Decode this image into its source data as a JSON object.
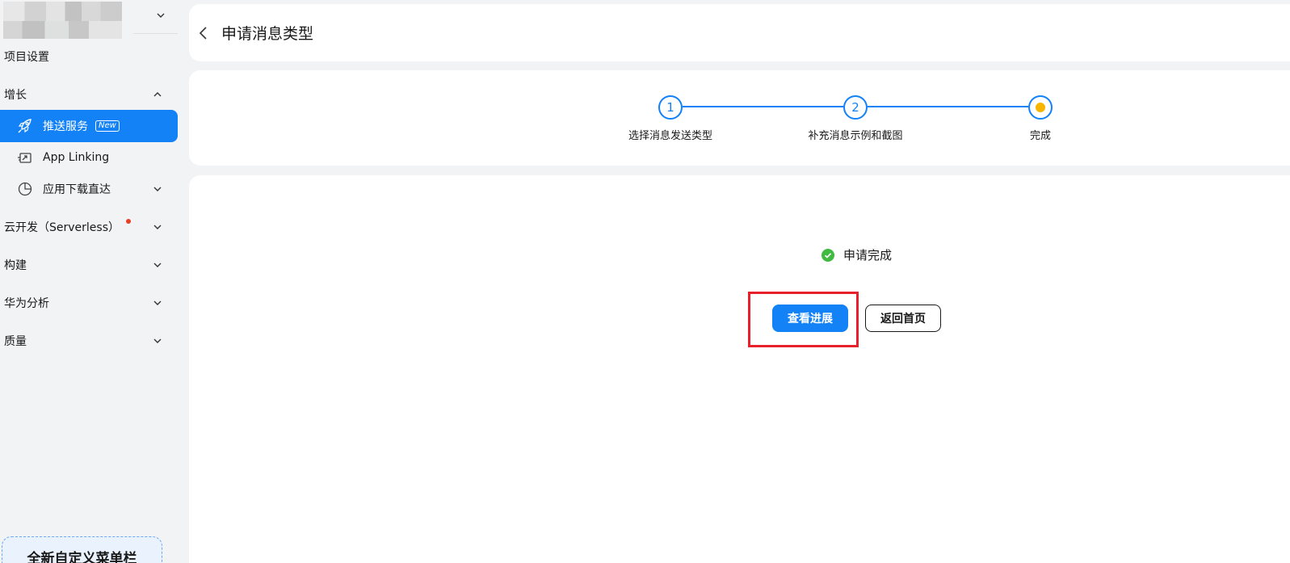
{
  "sidebar": {
    "project_settings": "项目设置",
    "growth": "增长",
    "items": [
      {
        "label": "推送服务",
        "badge": "New"
      },
      {
        "label": "App Linking"
      },
      {
        "label": "应用下载直达"
      }
    ],
    "cloud_dev": "云开发（Serverless）",
    "build": "构建",
    "analytics": "华为分析",
    "quality": "质量",
    "custom_menu": "全新自定义菜单栏"
  },
  "header": {
    "title": "申请消息类型"
  },
  "steps": [
    {
      "number": "1",
      "label": "选择消息发送类型"
    },
    {
      "number": "2",
      "label": "补充消息示例和截图"
    },
    {
      "number": "",
      "label": "完成"
    }
  ],
  "result": {
    "status": "申请完成",
    "view_progress": "查看进展",
    "back_home": "返回首页"
  },
  "colors": {
    "primary": "#1382f7",
    "success": "#41ba41",
    "current_step": "#f7b500",
    "highlight": "#e8202c"
  }
}
